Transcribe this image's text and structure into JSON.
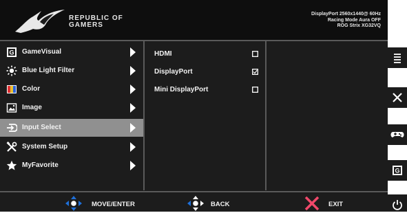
{
  "header": {
    "brand_line1": "REPUBLIC OF",
    "brand_line2": "GAMERS",
    "status_line1": "DisplayPort 2560x1440@ 60Hz",
    "status_line2": "Racing Mode Aura OFF",
    "status_line3": "ROG Strix XG32VQ"
  },
  "menu": {
    "items": [
      {
        "label": "GameVisual",
        "icon": "gamevisual-icon"
      },
      {
        "label": "Blue Light Filter",
        "icon": "blue-light-icon"
      },
      {
        "label": "Color",
        "icon": "color-icon"
      },
      {
        "label": "Image",
        "icon": "image-icon"
      },
      {
        "label": "Input Select",
        "icon": "input-select-icon",
        "selected": true
      },
      {
        "label": "System Setup",
        "icon": "system-setup-icon"
      },
      {
        "label": "MyFavorite",
        "icon": "star-icon"
      }
    ]
  },
  "submenu": {
    "options": [
      {
        "label": "HDMI",
        "checked": false
      },
      {
        "label": "DisplayPort",
        "checked": true
      },
      {
        "label": "Mini DisplayPort",
        "checked": false
      }
    ]
  },
  "footer": {
    "move_label": "MOVE/ENTER",
    "back_label": "BACK",
    "exit_label": "EXIT"
  },
  "side_buttons": [
    "menu-icon",
    "close-icon",
    "gamepad-icon",
    "gamevisual-icon",
    "power-icon"
  ],
  "colors": {
    "accent_blue": "#1e6fd8",
    "exit_pink": "#f0486a",
    "selection": "#909090"
  }
}
